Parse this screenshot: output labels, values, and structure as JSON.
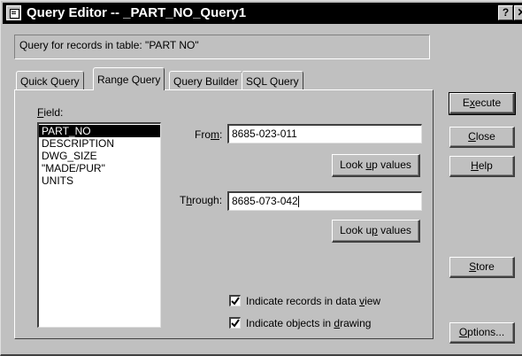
{
  "window": {
    "title": "Query Editor -- _PART_NO_Query1",
    "help_btn": "?",
    "close_btn": "✕"
  },
  "info": {
    "text": "Query for records in table:  \"PART NO\""
  },
  "tabs": [
    {
      "label": "Quick Query",
      "active": false
    },
    {
      "label": "Range Query",
      "active": true
    },
    {
      "label": "Query Builder",
      "active": false
    },
    {
      "label": "SQL Query",
      "active": false
    }
  ],
  "range_query": {
    "field_label": {
      "pre": "",
      "key": "F",
      "post": "ield:"
    },
    "fields": [
      "PART_NO",
      "DESCRIPTION",
      "DWG_SIZE",
      "\"MADE/PUR\"",
      "UNITS"
    ],
    "selected_field": "PART_NO",
    "from_label": {
      "pre": "Fro",
      "key": "m",
      "post": ":"
    },
    "from_value": "8685-023-011",
    "through_label": {
      "pre": "T",
      "key": "h",
      "post": "rough:"
    },
    "through_value": "8685-073-042",
    "lookup_from": {
      "pre": "Look ",
      "key": "u",
      "post": "p values"
    },
    "lookup_through": {
      "pre": "Look u",
      "key": "p",
      "post": " values"
    },
    "check_data_view": {
      "pre": "Indicate records in data ",
      "key": "v",
      "post": "iew",
      "checked": true
    },
    "check_drawing": {
      "pre": "Indicate objects in ",
      "key": "d",
      "post": "rawing",
      "checked": true
    }
  },
  "buttons": {
    "execute": {
      "pre": "E",
      "key": "x",
      "post": "ecute"
    },
    "close": {
      "pre": "",
      "key": "C",
      "post": "lose"
    },
    "help": {
      "pre": "",
      "key": "H",
      "post": "elp"
    },
    "store": {
      "pre": "",
      "key": "S",
      "post": "tore"
    },
    "options": {
      "pre": "",
      "key": "O",
      "post": "ptions..."
    }
  }
}
